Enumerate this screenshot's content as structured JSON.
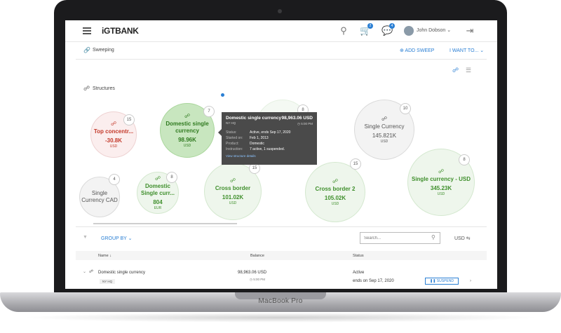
{
  "device": {
    "label": "MacBook Pro"
  },
  "app": {
    "logo": "iGTBANK",
    "user": "John Dobson",
    "cart_badge": "2",
    "chat_badge": "4"
  },
  "subheader": {
    "title": "Sweeping",
    "add_sweep": "ADD SWEEP",
    "i_want_to": "I WANT TO..."
  },
  "section": {
    "title": "Structures"
  },
  "bubbles": [
    {
      "name": "Top concentr...",
      "amount": "-30.8K",
      "currency": "USD",
      "count": "15"
    },
    {
      "name": "Domestic single currency",
      "amount": "98.96K",
      "currency": "USD",
      "count": "7"
    },
    {
      "name": "",
      "amount": "",
      "currency": "",
      "count": "8"
    },
    {
      "name": "Single Currency",
      "amount": "145.821K",
      "currency": "USD",
      "count": "10"
    },
    {
      "name": "Single Currency CAD",
      "amount": "",
      "currency": "",
      "count": "4"
    },
    {
      "name": "Domestic Single curr...",
      "amount": "804",
      "currency": "EUR",
      "count": "8"
    },
    {
      "name": "Cross border",
      "amount": "101.02K",
      "currency": "USD",
      "count": "15"
    },
    {
      "name": "Cross border 2",
      "amount": "105.02K",
      "currency": "USD",
      "count": "15"
    },
    {
      "name": "Single currency - USD",
      "amount": "345.23K",
      "currency": "USD",
      "count": "8"
    }
  ],
  "tooltip": {
    "title": "Domestic single currency",
    "subtitle": "NY HQ",
    "amount": "98,963.06 USD",
    "time": "5:00 PM",
    "rows": [
      {
        "k": "Status:",
        "v": "Active, ends Sep 17, 2020"
      },
      {
        "k": "Started on:",
        "v": "Feb 1, 2013"
      },
      {
        "k": "Product:",
        "v": "Domestic"
      },
      {
        "k": "Instruction:",
        "v": "7 active, 1 suspended."
      }
    ],
    "link": "View structure details"
  },
  "toolbar": {
    "group_by": "GROUP BY",
    "search_placeholder": "Search...",
    "currency": "USD"
  },
  "table": {
    "headers": {
      "name": "Name",
      "balance": "Balance",
      "status": "Status"
    },
    "rows": [
      {
        "name": "Domestic single currency",
        "tag": "NY HQ",
        "balance": "98,963.06 USD",
        "time": "5:00 PM",
        "status": "Active",
        "ends": "ends on Sep 17, 2020",
        "action": "SUSPEND"
      }
    ]
  },
  "colors": {
    "accent": "#2a7fd4",
    "positive": "#3f8f2c",
    "negative": "#c43b2c"
  }
}
